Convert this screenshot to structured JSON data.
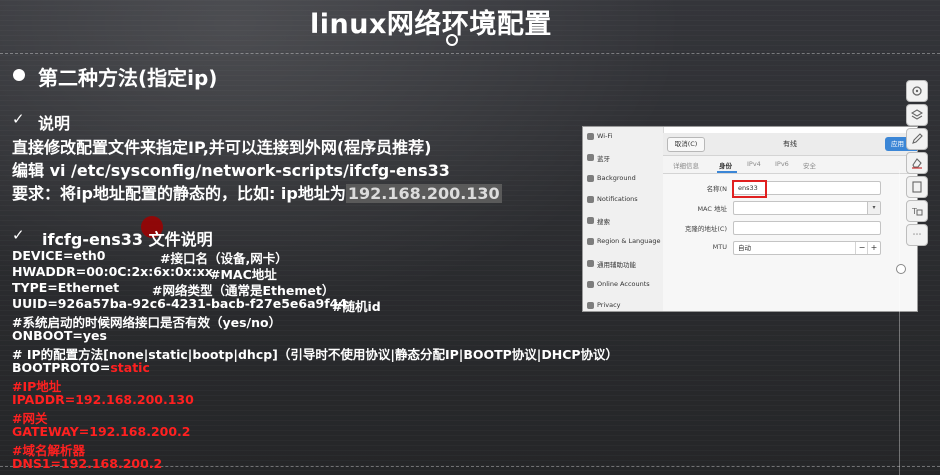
{
  "slide": {
    "title": "linux网络环境配置",
    "method_heading": "第二种方法(指定ip)",
    "section1": {
      "check": "✓",
      "heading": "说明",
      "line1": "直接修改配置文件来指定IP,并可以连接到外网(程序员推荐)",
      "line2": "编辑    vi /etc/sysconfig/network-scripts/ifcfg-ens33",
      "line3_prefix": "要求：将ip地址配置的静态的，比如: ip地址为",
      "line3_ip": "192.168.200.130"
    },
    "section2": {
      "check": "✓",
      "heading": "ifcfg-ens33 文件说明"
    },
    "config_lines": [
      {
        "key": "DEVICE=eth0",
        "comment": "#接口名（设备,网卡）"
      },
      {
        "key": "HWADDR=00:0C:2x:6x:0x:xx",
        "comment": "#MAC地址"
      },
      {
        "key": "TYPE=Ethernet",
        "comment": "#网络类型（通常是Ethemet）"
      },
      {
        "key": "UUID=926a57ba-92c6-4231-bacb-f27e5e6a9f44",
        "comment": "#随机id"
      }
    ],
    "onboot_comment": "#系统启动的时候网络接口是否有效（yes/no）",
    "onboot": "ONBOOT=yes",
    "bootproto_comment": "# IP的配置方法[none|static|bootp|dhcp]（引导时不使用协议|静态分配IP|BOOTP协议|DHCP协议）",
    "bootproto_key": "BOOTPROTO=",
    "bootproto_value": "static",
    "red_lines": [
      "#IP地址",
      "IPADDR=192.168.200.130",
      "#网关",
      "GATEWAY=192.168.200.2",
      "#域名解析器",
      "DNS1=192.168.200.2"
    ]
  },
  "window": {
    "sidebar": [
      {
        "icon": "wifi-icon",
        "label": "Wi-Fi"
      },
      {
        "icon": "bluetooth-icon",
        "label": "蓝牙"
      },
      {
        "icon": "background-icon",
        "label": "Background"
      },
      {
        "icon": "notifications-icon",
        "label": "Notifications"
      },
      {
        "icon": "search-icon",
        "label": "搜索"
      },
      {
        "icon": "region-icon",
        "label": "Region & Language"
      },
      {
        "icon": "accessibility-icon",
        "label": "通用辅助功能"
      },
      {
        "icon": "online-accounts-icon",
        "label": "Online Accounts"
      },
      {
        "icon": "privacy-icon",
        "label": "Privacy"
      }
    ],
    "cancel_label": "取消(C)",
    "dialog_title": "有线",
    "apply_label": "应用",
    "tabs": [
      "详细信息",
      "身份",
      "IPv4",
      "IPv6",
      "安全"
    ],
    "active_tab": "身份",
    "fields": {
      "name_label": "名称(N",
      "name_value": "ens33",
      "mac_label": "MAC 地址",
      "mac_value": "",
      "clone_label": "克隆的地址(C)",
      "clone_value": "",
      "mtu_label": "MTU",
      "mtu_value": "自动",
      "mtu_minus": "−",
      "mtu_plus": "+"
    }
  },
  "toolbar": {
    "buttons": [
      "pen-icon",
      "layers-icon",
      "marker-icon",
      "eraser-icon",
      "page-icon",
      "text-box-icon",
      "more-icon"
    ]
  }
}
